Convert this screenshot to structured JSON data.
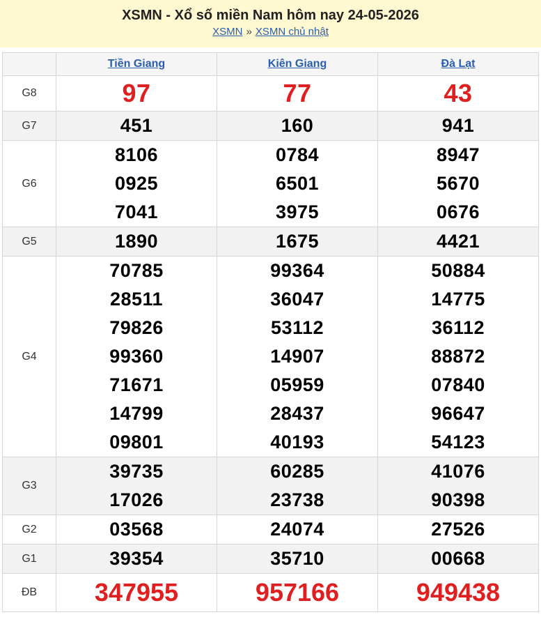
{
  "header": {
    "title": "XSMN - Xổ số miền Nam hôm nay 24-05-2026",
    "crumb_1": "XSMN",
    "separator": "»",
    "crumb_2": "XSMN chủ nhật"
  },
  "provinces": [
    "Tiền Giang",
    "Kiên Giang",
    "Đà Lạt"
  ],
  "prizes": [
    {
      "label": "G8",
      "values": [
        [
          "97"
        ],
        [
          "77"
        ],
        [
          "43"
        ]
      ]
    },
    {
      "label": "G7",
      "values": [
        [
          "451"
        ],
        [
          "160"
        ],
        [
          "941"
        ]
      ]
    },
    {
      "label": "G6",
      "values": [
        [
          "8106",
          "0925",
          "7041"
        ],
        [
          "0784",
          "6501",
          "3975"
        ],
        [
          "8947",
          "5670",
          "0676"
        ]
      ]
    },
    {
      "label": "G5",
      "values": [
        [
          "1890"
        ],
        [
          "1675"
        ],
        [
          "4421"
        ]
      ]
    },
    {
      "label": "G4",
      "values": [
        [
          "70785",
          "28511",
          "79826",
          "99360",
          "71671",
          "14799",
          "09801"
        ],
        [
          "99364",
          "36047",
          "53112",
          "14907",
          "05959",
          "28437",
          "40193"
        ],
        [
          "50884",
          "14775",
          "36112",
          "88872",
          "07840",
          "96647",
          "54123"
        ]
      ]
    },
    {
      "label": "G3",
      "values": [
        [
          "39735",
          "17026"
        ],
        [
          "60285",
          "23738"
        ],
        [
          "41076",
          "90398"
        ]
      ]
    },
    {
      "label": "G2",
      "values": [
        [
          "03568"
        ],
        [
          "24074"
        ],
        [
          "27526"
        ]
      ]
    },
    {
      "label": "G1",
      "values": [
        [
          "39354"
        ],
        [
          "35710"
        ],
        [
          "00668"
        ]
      ]
    },
    {
      "label": "ĐB",
      "values": [
        [
          "347955"
        ],
        [
          "957166"
        ],
        [
          "949438"
        ]
      ]
    }
  ],
  "colors": {
    "header_bg": "#fff8d0",
    "link": "#2a5db0",
    "highlight_number": "#e02020",
    "alt_row_bg": "#f2f2f2"
  }
}
